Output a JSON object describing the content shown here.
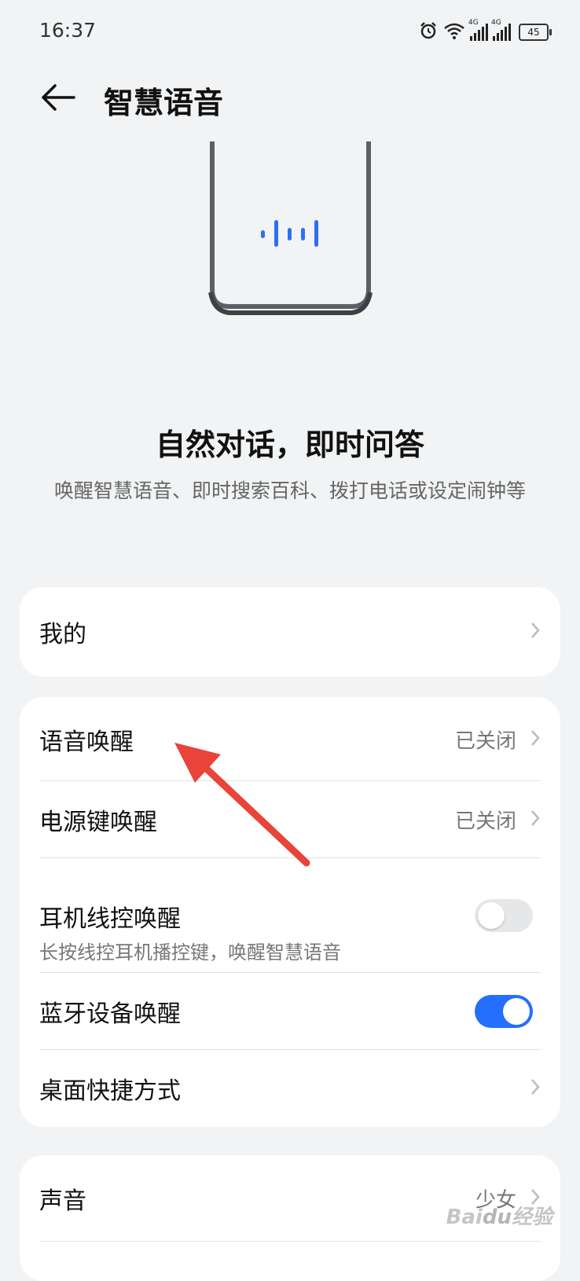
{
  "status_bar": {
    "time": "16:37",
    "network_1": "4G",
    "network_2": "4G",
    "battery": "45"
  },
  "header": {
    "title": "智慧语音",
    "back_icon": "back-arrow-icon"
  },
  "hero": {
    "title": "自然对话，即时问答",
    "subtitle": "唤醒智慧语音、即时搜索百科、拨打电话或设定闹钟等"
  },
  "cards": {
    "mine": {
      "label": "我的"
    },
    "wake": {
      "voice_wake": {
        "label": "语音唤醒",
        "value": "已关闭"
      },
      "power_key_wake": {
        "label": "电源键唤醒",
        "value": "已关闭"
      },
      "headset_wake": {
        "label": "耳机线控唤醒",
        "desc": "长按线控耳机播控键，唤醒智慧语音",
        "enabled": false
      },
      "bluetooth_wake": {
        "label": "蓝牙设备唤醒",
        "enabled": true
      },
      "desktop_shortcut": {
        "label": "桌面快捷方式"
      }
    },
    "voice": {
      "sound": {
        "label": "声音",
        "value": "少女"
      }
    }
  },
  "watermark": "Baidu经验",
  "colors": {
    "accent": "#256fff",
    "annotation_arrow": "#e8443a",
    "background": "#f1f3f5"
  }
}
